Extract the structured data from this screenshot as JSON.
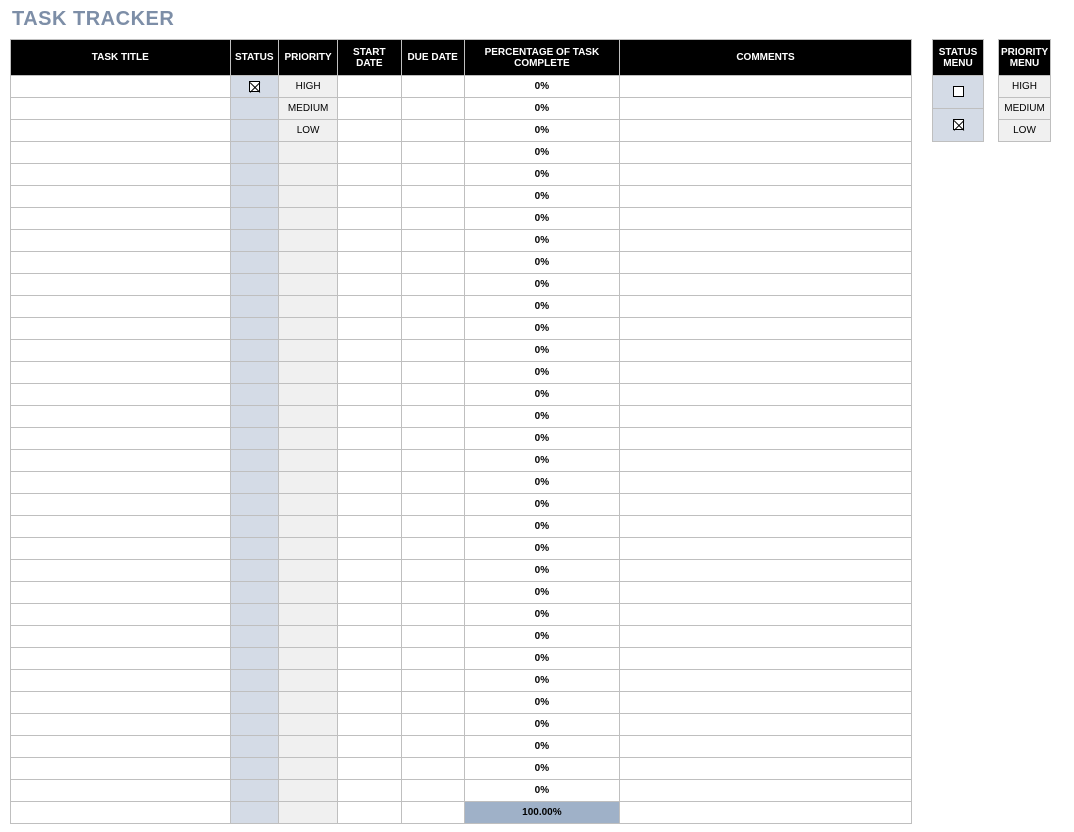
{
  "title": "TASK TRACKER",
  "columns": {
    "task_title": "TASK TITLE",
    "status": "STATUS",
    "priority": "PRIORITY",
    "start_date": "START DATE",
    "due_date": "DUE DATE",
    "pct_complete": "PERCENTAGE OF TASK COMPLETE",
    "comments": "COMMENTS"
  },
  "rows": [
    {
      "task_title": "",
      "status_checked": true,
      "priority": "HIGH",
      "start_date": "",
      "due_date": "",
      "pct": "0%",
      "comments": ""
    },
    {
      "task_title": "",
      "status_checked": false,
      "priority": "MEDIUM",
      "start_date": "",
      "due_date": "",
      "pct": "0%",
      "comments": ""
    },
    {
      "task_title": "",
      "status_checked": false,
      "priority": "LOW",
      "start_date": "",
      "due_date": "",
      "pct": "0%",
      "comments": ""
    },
    {
      "task_title": "",
      "status_checked": false,
      "priority": "",
      "start_date": "",
      "due_date": "",
      "pct": "0%",
      "comments": ""
    },
    {
      "task_title": "",
      "status_checked": false,
      "priority": "",
      "start_date": "",
      "due_date": "",
      "pct": "0%",
      "comments": ""
    },
    {
      "task_title": "",
      "status_checked": false,
      "priority": "",
      "start_date": "",
      "due_date": "",
      "pct": "0%",
      "comments": ""
    },
    {
      "task_title": "",
      "status_checked": false,
      "priority": "",
      "start_date": "",
      "due_date": "",
      "pct": "0%",
      "comments": ""
    },
    {
      "task_title": "",
      "status_checked": false,
      "priority": "",
      "start_date": "",
      "due_date": "",
      "pct": "0%",
      "comments": ""
    },
    {
      "task_title": "",
      "status_checked": false,
      "priority": "",
      "start_date": "",
      "due_date": "",
      "pct": "0%",
      "comments": ""
    },
    {
      "task_title": "",
      "status_checked": false,
      "priority": "",
      "start_date": "",
      "due_date": "",
      "pct": "0%",
      "comments": ""
    },
    {
      "task_title": "",
      "status_checked": false,
      "priority": "",
      "start_date": "",
      "due_date": "",
      "pct": "0%",
      "comments": ""
    },
    {
      "task_title": "",
      "status_checked": false,
      "priority": "",
      "start_date": "",
      "due_date": "",
      "pct": "0%",
      "comments": ""
    },
    {
      "task_title": "",
      "status_checked": false,
      "priority": "",
      "start_date": "",
      "due_date": "",
      "pct": "0%",
      "comments": ""
    },
    {
      "task_title": "",
      "status_checked": false,
      "priority": "",
      "start_date": "",
      "due_date": "",
      "pct": "0%",
      "comments": ""
    },
    {
      "task_title": "",
      "status_checked": false,
      "priority": "",
      "start_date": "",
      "due_date": "",
      "pct": "0%",
      "comments": ""
    },
    {
      "task_title": "",
      "status_checked": false,
      "priority": "",
      "start_date": "",
      "due_date": "",
      "pct": "0%",
      "comments": ""
    },
    {
      "task_title": "",
      "status_checked": false,
      "priority": "",
      "start_date": "",
      "due_date": "",
      "pct": "0%",
      "comments": ""
    },
    {
      "task_title": "",
      "status_checked": false,
      "priority": "",
      "start_date": "",
      "due_date": "",
      "pct": "0%",
      "comments": ""
    },
    {
      "task_title": "",
      "status_checked": false,
      "priority": "",
      "start_date": "",
      "due_date": "",
      "pct": "0%",
      "comments": ""
    },
    {
      "task_title": "",
      "status_checked": false,
      "priority": "",
      "start_date": "",
      "due_date": "",
      "pct": "0%",
      "comments": ""
    },
    {
      "task_title": "",
      "status_checked": false,
      "priority": "",
      "start_date": "",
      "due_date": "",
      "pct": "0%",
      "comments": ""
    },
    {
      "task_title": "",
      "status_checked": false,
      "priority": "",
      "start_date": "",
      "due_date": "",
      "pct": "0%",
      "comments": ""
    },
    {
      "task_title": "",
      "status_checked": false,
      "priority": "",
      "start_date": "",
      "due_date": "",
      "pct": "0%",
      "comments": ""
    },
    {
      "task_title": "",
      "status_checked": false,
      "priority": "",
      "start_date": "",
      "due_date": "",
      "pct": "0%",
      "comments": ""
    },
    {
      "task_title": "",
      "status_checked": false,
      "priority": "",
      "start_date": "",
      "due_date": "",
      "pct": "0%",
      "comments": ""
    },
    {
      "task_title": "",
      "status_checked": false,
      "priority": "",
      "start_date": "",
      "due_date": "",
      "pct": "0%",
      "comments": ""
    },
    {
      "task_title": "",
      "status_checked": false,
      "priority": "",
      "start_date": "",
      "due_date": "",
      "pct": "0%",
      "comments": ""
    },
    {
      "task_title": "",
      "status_checked": false,
      "priority": "",
      "start_date": "",
      "due_date": "",
      "pct": "0%",
      "comments": ""
    },
    {
      "task_title": "",
      "status_checked": false,
      "priority": "",
      "start_date": "",
      "due_date": "",
      "pct": "0%",
      "comments": ""
    },
    {
      "task_title": "",
      "status_checked": false,
      "priority": "",
      "start_date": "",
      "due_date": "",
      "pct": "0%",
      "comments": ""
    },
    {
      "task_title": "",
      "status_checked": false,
      "priority": "",
      "start_date": "",
      "due_date": "",
      "pct": "0%",
      "comments": ""
    },
    {
      "task_title": "",
      "status_checked": false,
      "priority": "",
      "start_date": "",
      "due_date": "",
      "pct": "0%",
      "comments": ""
    },
    {
      "task_title": "",
      "status_checked": false,
      "priority": "",
      "start_date": "",
      "due_date": "",
      "pct": "0%",
      "comments": ""
    }
  ],
  "footer": {
    "total_pct": "100.00%"
  },
  "status_menu": {
    "header": "STATUS MENU",
    "items": [
      {
        "checked": false
      },
      {
        "checked": true
      }
    ]
  },
  "priority_menu": {
    "header": "PRIORITY MENU",
    "items": [
      "HIGH",
      "MEDIUM",
      "LOW"
    ]
  }
}
